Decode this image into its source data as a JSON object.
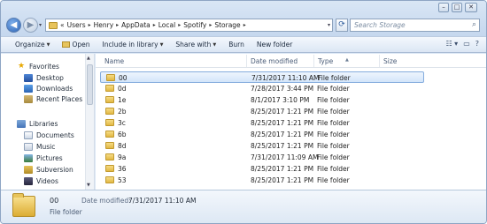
{
  "window": {
    "controls": {
      "minimize": "–",
      "maximize": "□",
      "close": "✕"
    }
  },
  "address": {
    "overflow": "«",
    "crumbs": [
      "Users",
      "Henry",
      "AppData",
      "Local",
      "Spotify",
      "Storage"
    ],
    "dropdown_glyph": "▾"
  },
  "search": {
    "placeholder": "Search Storage",
    "icon": "magnifier-icon"
  },
  "toolbar": {
    "organize": "Organize",
    "open": "Open",
    "include": "Include in library",
    "share": "Share with",
    "burn": "Burn",
    "new_folder": "New folder"
  },
  "nav": {
    "favorites": "Favorites",
    "desktop": "Desktop",
    "downloads": "Downloads",
    "recent": "Recent Places",
    "libraries": "Libraries",
    "documents": "Documents",
    "music": "Music",
    "pictures": "Pictures",
    "subversion": "Subversion",
    "videos": "Videos"
  },
  "columns": {
    "name": "Name",
    "date": "Date modified",
    "type": "Type",
    "size": "Size"
  },
  "files": [
    {
      "name": "00",
      "date": "7/31/2017 11:10 AM",
      "type": "File folder",
      "selected": true
    },
    {
      "name": "0d",
      "date": "7/28/2017 3:44 PM",
      "type": "File folder"
    },
    {
      "name": "1e",
      "date": "8/1/2017 3:10 PM",
      "type": "File folder"
    },
    {
      "name": "2b",
      "date": "8/25/2017 1:21 PM",
      "type": "File folder"
    },
    {
      "name": "3c",
      "date": "8/25/2017 1:21 PM",
      "type": "File folder"
    },
    {
      "name": "6b",
      "date": "8/25/2017 1:21 PM",
      "type": "File folder"
    },
    {
      "name": "8d",
      "date": "8/25/2017 1:21 PM",
      "type": "File folder"
    },
    {
      "name": "9a",
      "date": "7/31/2017 11:09 AM",
      "type": "File folder"
    },
    {
      "name": "36",
      "date": "8/25/2017 1:21 PM",
      "type": "File folder"
    },
    {
      "name": "53",
      "date": "8/25/2017 1:21 PM",
      "type": "File folder"
    }
  ],
  "details": {
    "name": "00",
    "modified_label": "Date modified:",
    "modified_value": "7/31/2017 11:10 AM",
    "type": "File folder"
  }
}
